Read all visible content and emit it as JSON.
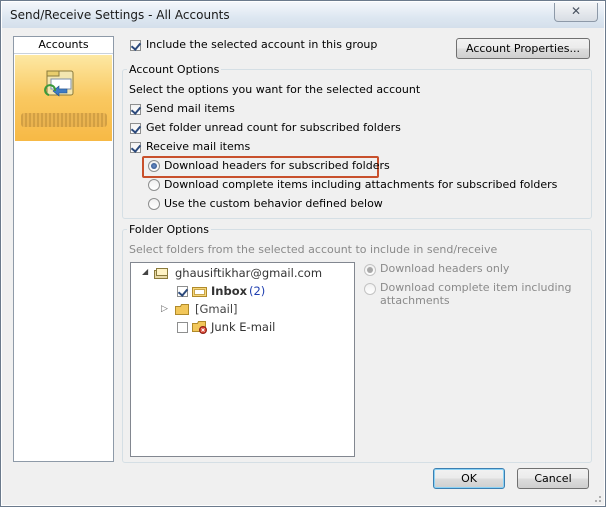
{
  "window": {
    "title": "Send/Receive Settings - All Accounts",
    "close_glyph": "✕"
  },
  "accounts": {
    "header": "Accounts"
  },
  "top": {
    "include_label": "Include the selected account in this group",
    "include_checked": true,
    "account_properties_label": "Account Properties..."
  },
  "account_options": {
    "legend": "Account Options",
    "instruction": "Select the options you want for the selected account",
    "send_mail": {
      "label": "Send mail items",
      "checked": true
    },
    "unread_count": {
      "label": "Get folder unread count for subscribed folders",
      "checked": true
    },
    "receive_mail": {
      "label": "Receive mail items",
      "checked": true
    },
    "radios": [
      {
        "label": "Download headers for subscribed folders",
        "selected": true
      },
      {
        "label": "Download complete items including attachments for subscribed folders",
        "selected": false
      },
      {
        "label": "Use the custom behavior defined below",
        "selected": false
      }
    ],
    "highlight_color": "#c8502c"
  },
  "folder_options": {
    "legend": "Folder Options",
    "instruction": "Select folders from the selected account to include in send/receive",
    "tree": {
      "account": "ghausiftikhar@gmail.com",
      "inbox_label": "Inbox",
      "inbox_count": "(2)",
      "gmail_label": "[Gmail]",
      "junk_label": "Junk E-mail"
    },
    "radios": [
      {
        "label": "Download headers only",
        "selected": true
      },
      {
        "label_line1": "Download complete item including",
        "label_line2": "attachments",
        "selected": false
      }
    ]
  },
  "footer": {
    "ok_label": "OK",
    "cancel_label": "Cancel"
  },
  "icons": {
    "close": "close-icon",
    "accounts_folder": "send-receive-folder-icon",
    "expand": "triangle-icon"
  }
}
